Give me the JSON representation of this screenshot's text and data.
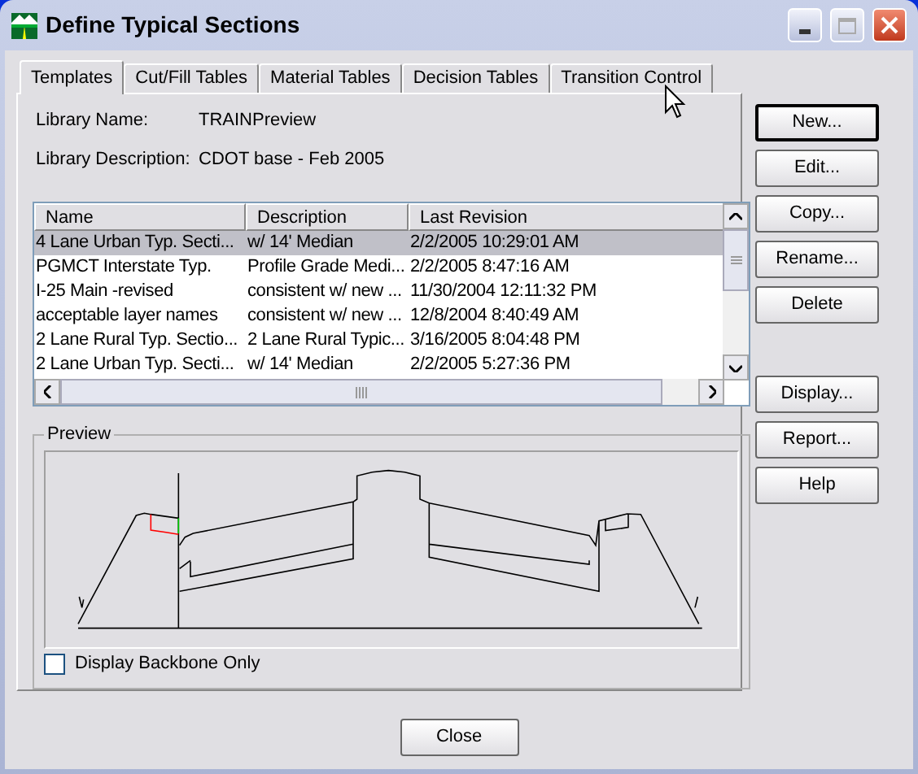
{
  "window": {
    "title": "Define Typical Sections"
  },
  "tabs": [
    {
      "label": "Templates",
      "selected": true
    },
    {
      "label": "Cut/Fill Tables",
      "selected": false
    },
    {
      "label": "Material Tables",
      "selected": false
    },
    {
      "label": "Decision Tables",
      "selected": false
    },
    {
      "label": "Transition Control",
      "selected": false
    }
  ],
  "library_name": {
    "label": "Library Name:",
    "value": "TRAINPreview"
  },
  "library_description": {
    "label": "Library Description:",
    "value": "CDOT base - Feb 2005"
  },
  "table": {
    "columns": [
      "Name",
      "Description",
      "Last Revision"
    ],
    "rows": [
      {
        "cells": [
          "4 Lane Urban Typ. Secti...",
          "w/ 14' Median",
          "2/2/2005 10:29:01 AM"
        ],
        "selected": true
      },
      {
        "cells": [
          "PGMCT Interstate Typ.",
          "Profile Grade Medi...",
          "2/2/2005 8:47:16 AM"
        ],
        "selected": false
      },
      {
        "cells": [
          "I-25 Main -revised",
          "consistent w/ new ...",
          "11/30/2004 12:11:32 PM"
        ],
        "selected": false
      },
      {
        "cells": [
          "acceptable layer names",
          "consistent w/ new ...",
          "12/8/2004 8:40:49 AM"
        ],
        "selected": false
      },
      {
        "cells": [
          "2 Lane Rural Typ. Sectio...",
          "2 Lane Rural Typic...",
          "3/16/2005 8:04:48 PM"
        ],
        "selected": false
      },
      {
        "cells": [
          "2 Lane Urban Typ. Secti...",
          "w/ 14' Median",
          "2/2/2005 5:27:36 PM"
        ],
        "selected": false
      }
    ]
  },
  "side_buttons": [
    {
      "label": "New...",
      "default": true
    },
    {
      "label": "Edit...",
      "default": false
    },
    {
      "label": "Copy...",
      "default": false
    },
    {
      "label": "Rename...",
      "default": false
    },
    {
      "label": "Delete",
      "default": false
    }
  ],
  "side_buttons_2": [
    "Display...",
    "Report...",
    "Help"
  ],
  "preview": {
    "title": "Preview",
    "backbone_only": {
      "label": "Display Backbone Only",
      "checked": false
    }
  },
  "close_button": "Close"
}
